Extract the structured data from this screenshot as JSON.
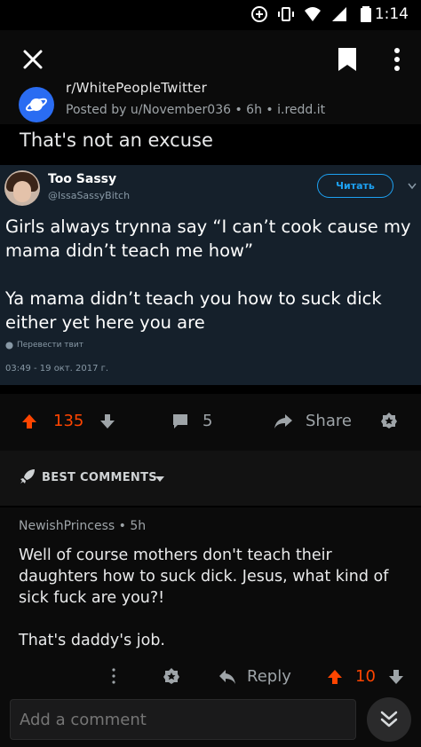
{
  "status_bar": {
    "time": "1:14"
  },
  "post": {
    "subreddit": "r/WhitePeopleTwitter",
    "meta": "Posted by u/November036 • 6h • i.redd.it",
    "title": "That's not an excuse"
  },
  "tweet": {
    "name": "Too Sassy",
    "handle": "@IssaSassyBitch",
    "follow_label": "Читать",
    "text": "Girls always trynna say “I can’t cook cause my mama didn’t teach me how”\n\nYa mama didn’t teach you how to suck dick either yet here you are",
    "translate_label": "Перевести твит",
    "date": "03:49 - 19 окт. 2017 г."
  },
  "votebar": {
    "score": "135",
    "comments": "5",
    "share_label": "Share"
  },
  "best_comments": {
    "label": "BEST COMMENTS"
  },
  "comment": {
    "author_line": "NewishPrincess • 5h",
    "body": "Well of course mothers don't teach their daughters how to suck dick. Jesus, what kind of sick fuck are you?!\n\nThat's daddy's job.",
    "reply_label": "Reply",
    "score": "10"
  },
  "composer": {
    "placeholder": "Add a comment"
  },
  "colors": {
    "accent": "#ff4500",
    "twitter_blue": "#1da1f2",
    "tweet_bg": "#15202b"
  }
}
